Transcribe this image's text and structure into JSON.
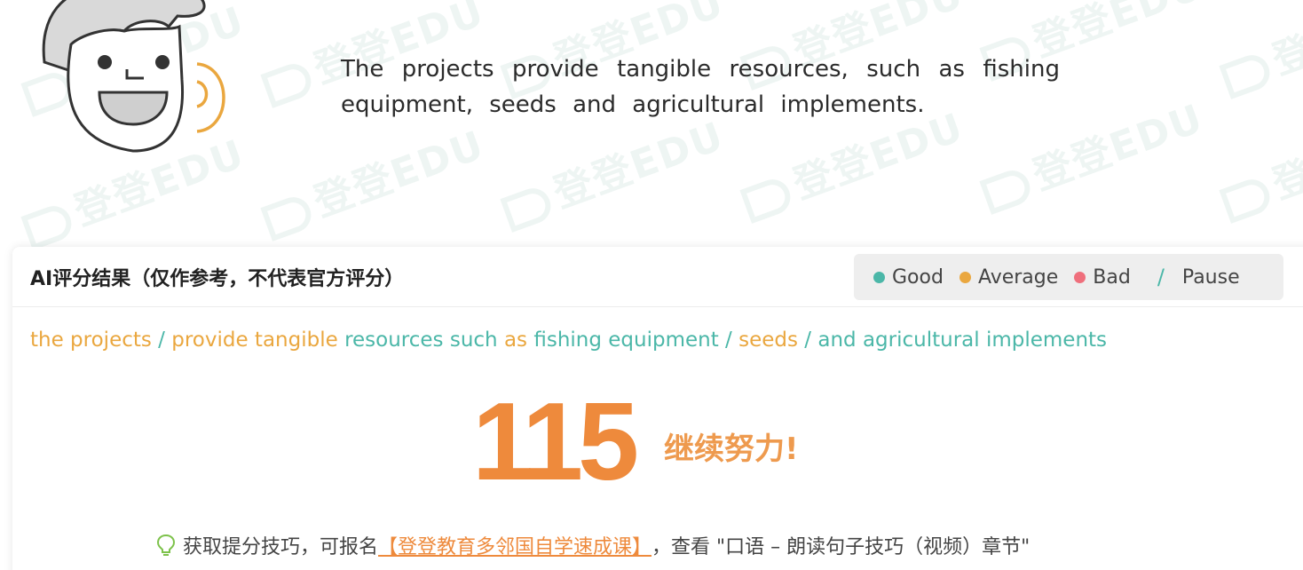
{
  "watermark_text": "登登EDU",
  "sentence": "The projects provide tangible resources, such as fishing equipment, seeds and agricultural implements.",
  "result_card": {
    "title": "AI评分结果（仅作参考，不代表官方评分）",
    "legend": {
      "good": "Good",
      "average": "Average",
      "bad": "Bad",
      "pause_slash": "/",
      "pause": "Pause"
    },
    "phrases": [
      {
        "text": "the projects",
        "rating": "average"
      },
      {
        "text": " / ",
        "rating": "pause"
      },
      {
        "text": "provide tangible",
        "rating": "average"
      },
      {
        "text": " resources such ",
        "rating": "good"
      },
      {
        "text": "as",
        "rating": "average"
      },
      {
        "text": " fishing equipment",
        "rating": "good"
      },
      {
        "text": " / ",
        "rating": "pause"
      },
      {
        "text": "seeds",
        "rating": "average"
      },
      {
        "text": " / ",
        "rating": "pause"
      },
      {
        "text": "and agricultural implements",
        "rating": "good"
      }
    ],
    "score": "115",
    "praise": "继续努力!",
    "tip": {
      "prefix": "获取提分技巧，可报名",
      "link": "【登登教育多邻国自学速成课】",
      "suffix": "，查看 \"口语 – 朗读句子技巧（视频）章节\""
    }
  },
  "colors": {
    "good": "#4bb7a8",
    "average": "#eaa73f",
    "bad": "#ef6f7c",
    "pause": "#4bb7a8",
    "score": "#ee8a3c",
    "tip_bulb": "#7dc24b"
  }
}
